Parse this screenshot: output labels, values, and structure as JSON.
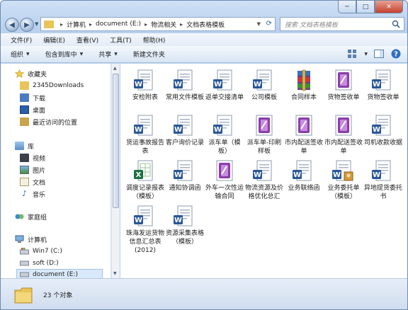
{
  "window": {
    "controls": {
      "minimize": "─",
      "maximize": "□",
      "close": "✕"
    }
  },
  "nav": {
    "back": "◀",
    "forward": "▶"
  },
  "address": {
    "crumbs": [
      "计算机",
      "document (E:)",
      "物流相关",
      "文档表格模板"
    ]
  },
  "search": {
    "placeholder": "搜索 文档表格模板"
  },
  "menu": [
    "文件(F)",
    "编辑(E)",
    "查看(V)",
    "工具(T)",
    "帮助(H)"
  ],
  "commands": {
    "organize": "组织",
    "include_in_library": "包含到库中",
    "share": "共享",
    "new_folder": "新建文件夹"
  },
  "sidebar": {
    "favorites": {
      "label": "收藏夹",
      "items": [
        "2345Downloads",
        "下载",
        "桌面",
        "最近访问的位置"
      ]
    },
    "libraries": {
      "label": "库",
      "items": [
        "视频",
        "图片",
        "文档",
        "音乐"
      ]
    },
    "homegroup": {
      "label": "家庭组"
    },
    "computer": {
      "label": "计算机",
      "items": [
        "Win7 (C:)",
        "soft (D:)",
        "document (E:)"
      ]
    }
  },
  "files": [
    {
      "name": "安检附表",
      "type": "word"
    },
    {
      "name": "常用文件模板",
      "type": "word"
    },
    {
      "name": "返单交接清单",
      "type": "word"
    },
    {
      "name": "公司模板",
      "type": "word"
    },
    {
      "name": "合同样本",
      "type": "rar"
    },
    {
      "name": "货物签收单",
      "type": "onenote"
    },
    {
      "name": "货物签收单",
      "type": "word"
    },
    {
      "name": "货运事故报告表",
      "type": "word"
    },
    {
      "name": "客户询价记录",
      "type": "word"
    },
    {
      "name": "派车单（模板）",
      "type": "word"
    },
    {
      "name": "派车单-印刷样板",
      "type": "onenote"
    },
    {
      "name": "市内配送签收单",
      "type": "onenote"
    },
    {
      "name": "市内配送签收单",
      "type": "onenote"
    },
    {
      "name": "司机收款收据",
      "type": "word"
    },
    {
      "name": "调度记录报表（模板）",
      "type": "excel"
    },
    {
      "name": "通知协调函",
      "type": "word"
    },
    {
      "name": "外车一次性运输合同",
      "type": "onenote"
    },
    {
      "name": "物流资源及价格优化总汇",
      "type": "word"
    },
    {
      "name": "业务联络函",
      "type": "word"
    },
    {
      "name": "业务委托单（模板）",
      "type": "word-img"
    },
    {
      "name": "异地提货委托书",
      "type": "word"
    },
    {
      "name": "珠海发运货物信息汇总表(2012)",
      "type": "word"
    },
    {
      "name": "资源采集表格（模板）",
      "type": "word"
    }
  ],
  "status": {
    "count": "23 个对象"
  }
}
